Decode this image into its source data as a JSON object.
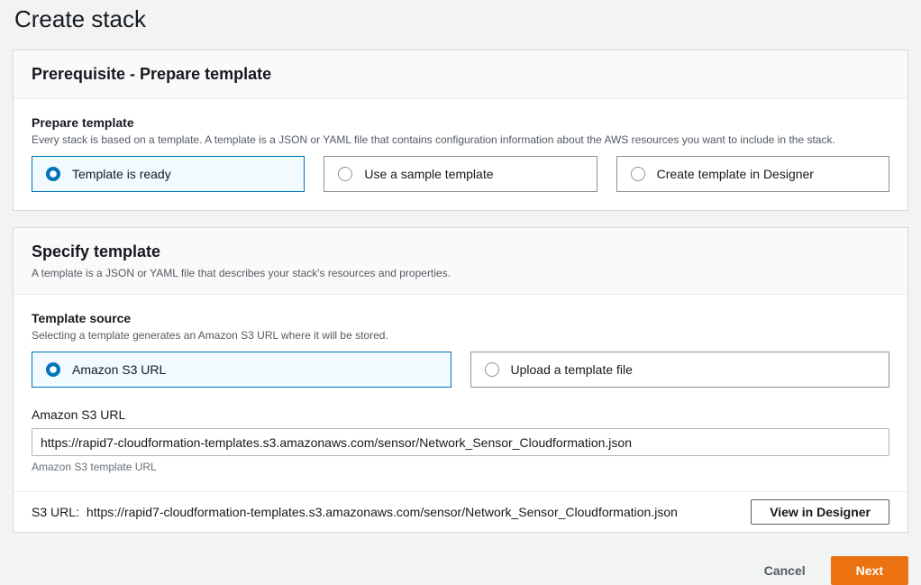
{
  "page": {
    "title": "Create stack"
  },
  "colors": {
    "accent_blue": "#0073bb",
    "selected_tile_bg": "#f1faff",
    "primary_orange": "#ec7211",
    "page_bg": "#f2f3f3"
  },
  "prerequisite_panel": {
    "header": "Prerequisite - Prepare template",
    "field_label": "Prepare template",
    "field_description": "Every stack is based on a template. A template is a JSON or YAML file that contains configuration information about the AWS resources you want to include in the stack.",
    "options": [
      {
        "label": "Template is ready",
        "selected": true
      },
      {
        "label": "Use a sample template",
        "selected": false
      },
      {
        "label": "Create template in Designer",
        "selected": false
      }
    ]
  },
  "specify_panel": {
    "header": "Specify template",
    "description": "A template is a JSON or YAML file that describes your stack's resources and properties.",
    "source_label": "Template source",
    "source_description": "Selecting a template generates an Amazon S3 URL where it will be stored.",
    "options": [
      {
        "label": "Amazon S3 URL",
        "selected": true
      },
      {
        "label": "Upload a template file",
        "selected": false
      }
    ],
    "url_field": {
      "label": "Amazon S3 URL",
      "value": "https://rapid7-cloudformation-templates.s3.amazonaws.com/sensor/Network_Sensor_Cloudformation.json",
      "helper": "Amazon S3 template URL"
    },
    "footer": {
      "label": "S3 URL:",
      "url": "https://rapid7-cloudformation-templates.s3.amazonaws.com/sensor/Network_Sensor_Cloudformation.json",
      "view_designer_button": "View in Designer"
    }
  },
  "actions": {
    "cancel": "Cancel",
    "next": "Next"
  }
}
